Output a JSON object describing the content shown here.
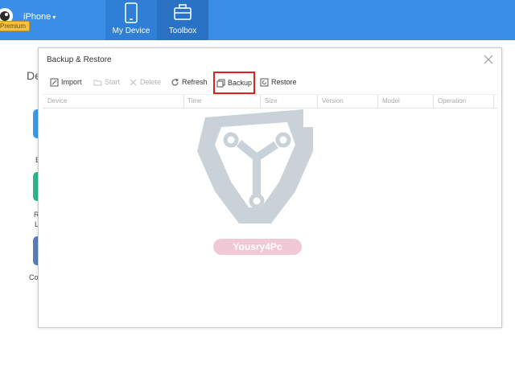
{
  "header": {
    "premium_badge": "Premium",
    "device_name": "iPhone",
    "caret": "▾",
    "tabs": [
      {
        "label": "My Device"
      },
      {
        "label": "Toolbox"
      }
    ],
    "accent_color": "#3a8ee6"
  },
  "background_page": {
    "heading": "De",
    "labels": [
      "E",
      "R",
      "L",
      "Co"
    ]
  },
  "dialog": {
    "title": "Backup & Restore",
    "toolbar": {
      "import": "Import",
      "start": "Start",
      "delete": "Delete",
      "refresh": "Refresh",
      "backup": "Backup",
      "restore": "Restore"
    },
    "columns": [
      "Device",
      "Time",
      "Size",
      "Version",
      "Model",
      "Operation"
    ],
    "rows": []
  },
  "watermark": {
    "text": "Yousry4Pc"
  }
}
